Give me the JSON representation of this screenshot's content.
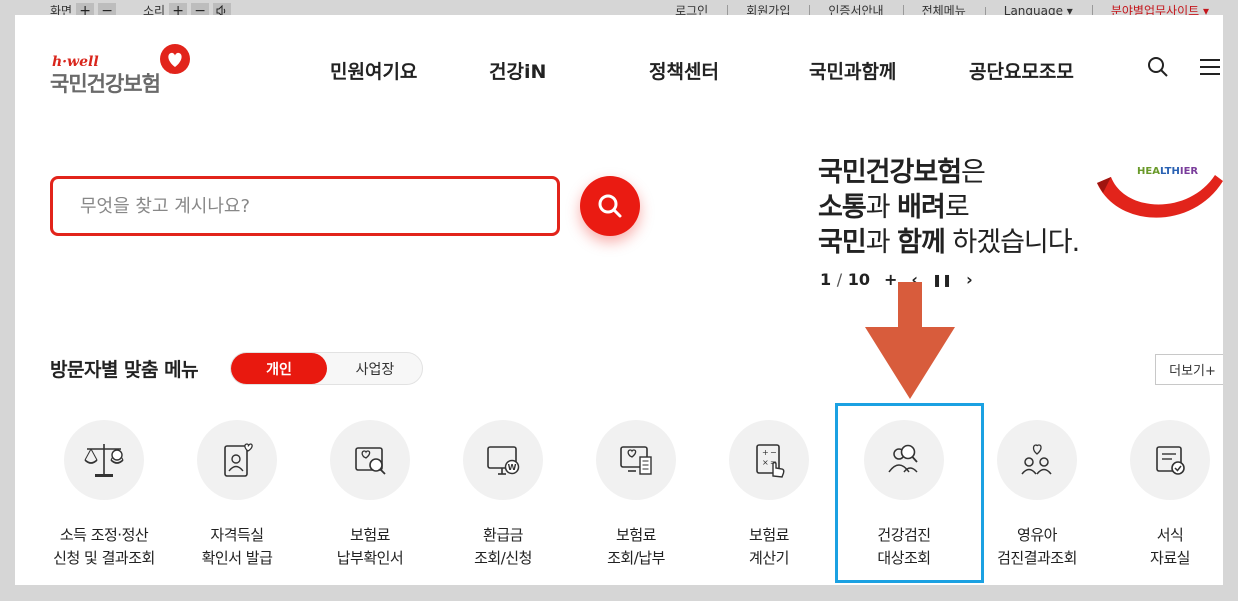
{
  "utility_bar": {
    "screen_label": "화면",
    "sound_label": "소리",
    "plus": "+",
    "minus": "−",
    "links": [
      "로그인",
      "회원가입",
      "인증서안내",
      "전체메뉴",
      "Language ▾",
      "분야별업무사이트 ▾"
    ]
  },
  "header": {
    "logo_en": "h·well",
    "logo_ko": "국민건강보험",
    "nav": [
      "민원여기요",
      "건강iN",
      "정책센터",
      "국민과함께",
      "공단요모조모"
    ]
  },
  "search": {
    "placeholder": "무엇을 찾고 계시나요?"
  },
  "banner": {
    "line1_bold": "국민건강보험",
    "line1_rest": "은",
    "line2_bold1": "소통",
    "line2_mid": "과 ",
    "line2_bold2": "배려",
    "line2_rest": "로",
    "line3_bold1": "국민",
    "line3_mid": "과 ",
    "line3_bold2": "함께",
    "line3_rest": " 하겠습니다.",
    "ribbon_part1": "HEA",
    "ribbon_part2": "LTH",
    "ribbon_part3": "IER",
    "page_current": "1",
    "page_sep": "/",
    "page_total": "10",
    "plus": "+",
    "prev": "‹",
    "pause": "❚❚",
    "next": "›"
  },
  "section": {
    "title": "방문자별 맞춤 메뉴",
    "tab_personal": "개인",
    "tab_business": "사업장",
    "more": "더보기+"
  },
  "menu_items": [
    {
      "line1": "소득 조정·정산",
      "line2": "신청 및 결과조회",
      "icon": "scale-icon"
    },
    {
      "line1": "자격득실",
      "line2": "확인서 발급",
      "icon": "id-card-icon"
    },
    {
      "line1": "보험료",
      "line2": "납부확인서",
      "icon": "document-search-icon"
    },
    {
      "line1": "환급금",
      "line2": "조회/신청",
      "icon": "monitor-coin-icon"
    },
    {
      "line1": "보험료",
      "line2": "조회/납부",
      "icon": "bill-icon"
    },
    {
      "line1": "보험료",
      "line2": "계산기",
      "icon": "calculator-icon"
    },
    {
      "line1": "건강검진",
      "line2": "대상조회",
      "icon": "person-search-icon"
    },
    {
      "line1": "영유아",
      "line2": "검진결과조회",
      "icon": "family-icon"
    },
    {
      "line1": "서식",
      "line2": "자료실",
      "icon": "form-icon"
    }
  ],
  "colors": {
    "brand_red": "#e8190f",
    "highlight_blue": "#1ba1e2",
    "arrow_orange": "#d85c3c"
  }
}
